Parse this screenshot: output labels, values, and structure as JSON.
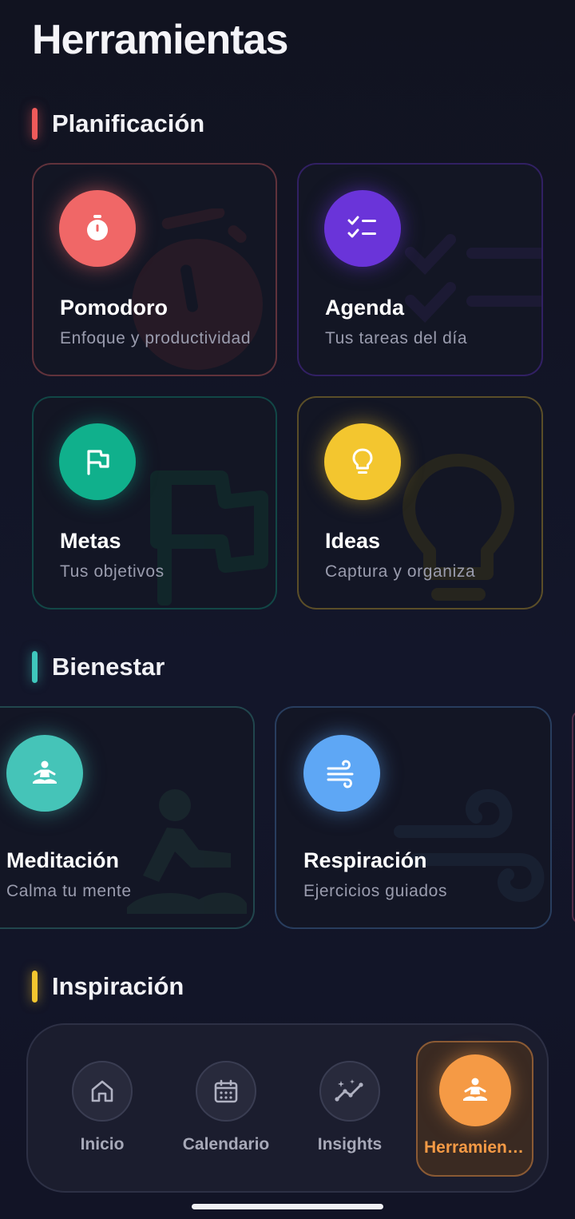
{
  "page": {
    "title": "Herramientas"
  },
  "sections": {
    "planificacion": {
      "title": "Planificación",
      "accent": "#ef5a5a",
      "cards": [
        {
          "name": "Pomodoro",
          "desc": "Enfoque y productividad",
          "icon": "timer-icon",
          "color": "#f06767"
        },
        {
          "name": "Agenda",
          "desc": "Tus tareas del día",
          "icon": "checklist-icon",
          "color": "#6a34d9"
        },
        {
          "name": "Metas",
          "desc": "Tus objetivos",
          "icon": "flag-icon",
          "color": "#10b08c"
        },
        {
          "name": "Ideas",
          "desc": "Captura y organiza",
          "icon": "lightbulb-icon",
          "color": "#f3c62f"
        }
      ]
    },
    "bienestar": {
      "title": "Bienestar",
      "accent": "#3fc8bd",
      "cards": [
        {
          "name": "Meditación",
          "desc": "Calma tu mente",
          "icon": "meditation-icon",
          "color": "#45c4b8"
        },
        {
          "name": "Respiración",
          "desc": "Ejercicios guiados",
          "icon": "wind-icon",
          "color": "#5ea7f5"
        }
      ]
    },
    "inspiracion": {
      "title": "Inspiración",
      "accent": "#f3c62f"
    }
  },
  "nav": {
    "items": [
      {
        "label": "Inicio",
        "icon": "home-icon"
      },
      {
        "label": "Calendario",
        "icon": "calendar-icon"
      },
      {
        "label": "Insights",
        "icon": "insights-icon"
      },
      {
        "label": "Herramientas",
        "icon": "meditation-icon",
        "active": true
      }
    ],
    "active_color": "#f59a45"
  }
}
